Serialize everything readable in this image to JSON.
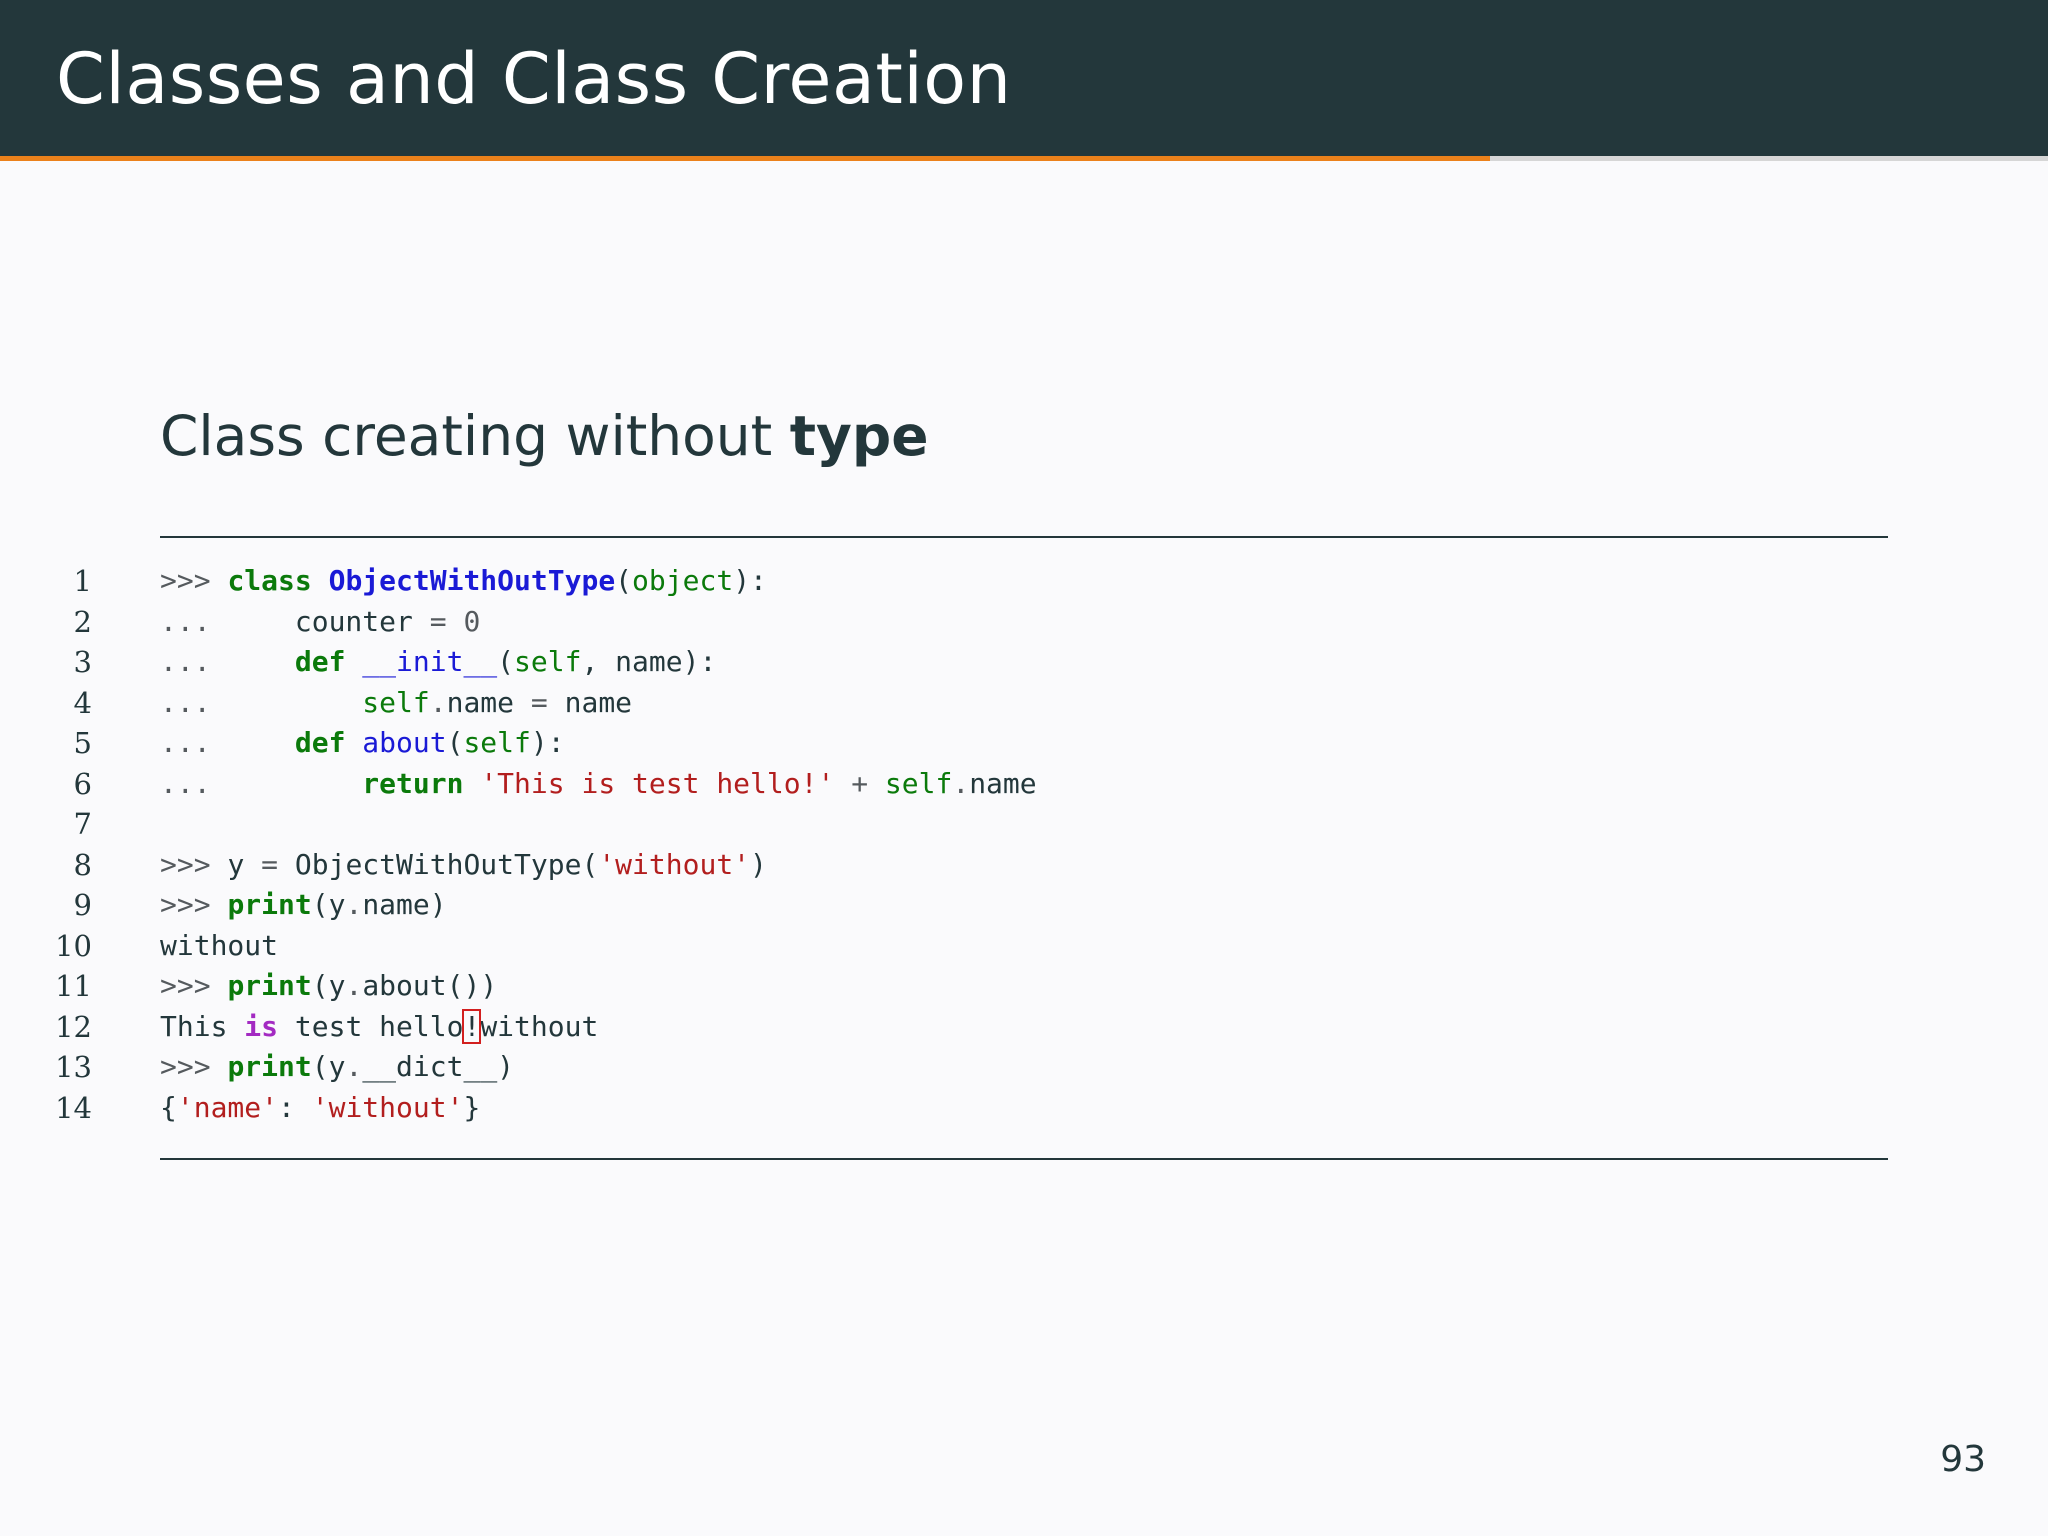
{
  "header": {
    "title": "Classes and Class Creation"
  },
  "progress": {
    "fraction": 0.7275,
    "fill_color": "#eb811b",
    "track_color": "#d6d6d6"
  },
  "subtitle": {
    "text": "Class creating without ",
    "keyword": "type"
  },
  "code": {
    "lines": [
      {
        "number": "1",
        "tokens": [
          {
            "text": ">>> ",
            "type": "prompt"
          },
          {
            "text": "class",
            "type": "kw"
          },
          {
            "text": " ",
            "type": "text"
          },
          {
            "text": "ObjectWithOutType",
            "type": "cls"
          },
          {
            "text": "(",
            "type": "text"
          },
          {
            "text": "object",
            "type": "builtin"
          },
          {
            "text": "):",
            "type": "text"
          }
        ]
      },
      {
        "number": "2",
        "tokens": [
          {
            "text": "...     ",
            "type": "prompt"
          },
          {
            "text": "counter ",
            "type": "text"
          },
          {
            "text": "=",
            "type": "op"
          },
          {
            "text": " ",
            "type": "text"
          },
          {
            "text": "0",
            "type": "num"
          }
        ]
      },
      {
        "number": "3",
        "tokens": [
          {
            "text": "...     ",
            "type": "prompt"
          },
          {
            "text": "def",
            "type": "kw"
          },
          {
            "text": " ",
            "type": "text"
          },
          {
            "text": "__init__",
            "type": "fn"
          },
          {
            "text": "(",
            "type": "text"
          },
          {
            "text": "self",
            "type": "builtin"
          },
          {
            "text": ", name):",
            "type": "text"
          }
        ]
      },
      {
        "number": "4",
        "tokens": [
          {
            "text": "...         ",
            "type": "prompt"
          },
          {
            "text": "self",
            "type": "builtin"
          },
          {
            "text": ".",
            "type": "op"
          },
          {
            "text": "name ",
            "type": "text"
          },
          {
            "text": "=",
            "type": "op"
          },
          {
            "text": " name",
            "type": "text"
          }
        ]
      },
      {
        "number": "5",
        "tokens": [
          {
            "text": "...     ",
            "type": "prompt"
          },
          {
            "text": "def",
            "type": "kw"
          },
          {
            "text": " ",
            "type": "text"
          },
          {
            "text": "about",
            "type": "fn"
          },
          {
            "text": "(",
            "type": "text"
          },
          {
            "text": "self",
            "type": "builtin"
          },
          {
            "text": "):",
            "type": "text"
          }
        ]
      },
      {
        "number": "6",
        "tokens": [
          {
            "text": "...         ",
            "type": "prompt"
          },
          {
            "text": "return",
            "type": "kw"
          },
          {
            "text": " ",
            "type": "text"
          },
          {
            "text": "'This is test hello!'",
            "type": "str"
          },
          {
            "text": " ",
            "type": "text"
          },
          {
            "text": "+",
            "type": "op"
          },
          {
            "text": " ",
            "type": "text"
          },
          {
            "text": "self",
            "type": "builtin"
          },
          {
            "text": ".",
            "type": "op"
          },
          {
            "text": "name",
            "type": "text"
          }
        ]
      },
      {
        "number": "7",
        "tokens": []
      },
      {
        "number": "8",
        "tokens": [
          {
            "text": ">>> ",
            "type": "prompt"
          },
          {
            "text": "y ",
            "type": "text"
          },
          {
            "text": "=",
            "type": "op"
          },
          {
            "text": " ObjectWithOutType(",
            "type": "text"
          },
          {
            "text": "'without'",
            "type": "str"
          },
          {
            "text": ")",
            "type": "text"
          }
        ]
      },
      {
        "number": "9",
        "tokens": [
          {
            "text": ">>> ",
            "type": "prompt"
          },
          {
            "text": "print",
            "type": "kw"
          },
          {
            "text": "(y",
            "type": "text"
          },
          {
            "text": ".",
            "type": "op"
          },
          {
            "text": "name)",
            "type": "text"
          }
        ]
      },
      {
        "number": "10",
        "tokens": [
          {
            "text": "without",
            "type": "text"
          }
        ]
      },
      {
        "number": "11",
        "tokens": [
          {
            "text": ">>> ",
            "type": "prompt"
          },
          {
            "text": "print",
            "type": "kw"
          },
          {
            "text": "(y",
            "type": "text"
          },
          {
            "text": ".",
            "type": "op"
          },
          {
            "text": "about())",
            "type": "text"
          }
        ]
      },
      {
        "number": "12",
        "tokens": [
          {
            "text": "This ",
            "type": "text"
          },
          {
            "text": "is",
            "type": "opword"
          },
          {
            "text": " test hello",
            "type": "text"
          },
          {
            "text": "!",
            "type": "err"
          },
          {
            "text": "without",
            "type": "text"
          }
        ]
      },
      {
        "number": "13",
        "tokens": [
          {
            "text": ">>> ",
            "type": "prompt"
          },
          {
            "text": "print",
            "type": "kw"
          },
          {
            "text": "(y",
            "type": "text"
          },
          {
            "text": ".",
            "type": "op"
          },
          {
            "text": "__dict__)",
            "type": "text"
          }
        ]
      },
      {
        "number": "14",
        "tokens": [
          {
            "text": "{",
            "type": "text"
          },
          {
            "text": "'name'",
            "type": "str"
          },
          {
            "text": ": ",
            "type": "text"
          },
          {
            "text": "'without'",
            "type": "str"
          },
          {
            "text": "}",
            "type": "text"
          }
        ]
      }
    ]
  },
  "footer": {
    "page_number": "93"
  }
}
